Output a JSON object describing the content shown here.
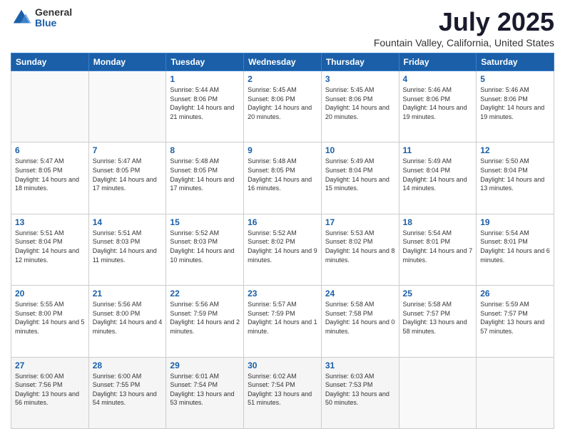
{
  "header": {
    "logo": {
      "general": "General",
      "blue": "Blue"
    },
    "title": "July 2025",
    "subtitle": "Fountain Valley, California, United States"
  },
  "calendar": {
    "weekdays": [
      "Sunday",
      "Monday",
      "Tuesday",
      "Wednesday",
      "Thursday",
      "Friday",
      "Saturday"
    ],
    "weeks": [
      [
        {
          "day": "",
          "sunrise": "",
          "sunset": "",
          "daylight": ""
        },
        {
          "day": "",
          "sunrise": "",
          "sunset": "",
          "daylight": ""
        },
        {
          "day": "1",
          "sunrise": "Sunrise: 5:44 AM",
          "sunset": "Sunset: 8:06 PM",
          "daylight": "Daylight: 14 hours and 21 minutes."
        },
        {
          "day": "2",
          "sunrise": "Sunrise: 5:45 AM",
          "sunset": "Sunset: 8:06 PM",
          "daylight": "Daylight: 14 hours and 20 minutes."
        },
        {
          "day": "3",
          "sunrise": "Sunrise: 5:45 AM",
          "sunset": "Sunset: 8:06 PM",
          "daylight": "Daylight: 14 hours and 20 minutes."
        },
        {
          "day": "4",
          "sunrise": "Sunrise: 5:46 AM",
          "sunset": "Sunset: 8:06 PM",
          "daylight": "Daylight: 14 hours and 19 minutes."
        },
        {
          "day": "5",
          "sunrise": "Sunrise: 5:46 AM",
          "sunset": "Sunset: 8:06 PM",
          "daylight": "Daylight: 14 hours and 19 minutes."
        }
      ],
      [
        {
          "day": "6",
          "sunrise": "Sunrise: 5:47 AM",
          "sunset": "Sunset: 8:05 PM",
          "daylight": "Daylight: 14 hours and 18 minutes."
        },
        {
          "day": "7",
          "sunrise": "Sunrise: 5:47 AM",
          "sunset": "Sunset: 8:05 PM",
          "daylight": "Daylight: 14 hours and 17 minutes."
        },
        {
          "day": "8",
          "sunrise": "Sunrise: 5:48 AM",
          "sunset": "Sunset: 8:05 PM",
          "daylight": "Daylight: 14 hours and 17 minutes."
        },
        {
          "day": "9",
          "sunrise": "Sunrise: 5:48 AM",
          "sunset": "Sunset: 8:05 PM",
          "daylight": "Daylight: 14 hours and 16 minutes."
        },
        {
          "day": "10",
          "sunrise": "Sunrise: 5:49 AM",
          "sunset": "Sunset: 8:04 PM",
          "daylight": "Daylight: 14 hours and 15 minutes."
        },
        {
          "day": "11",
          "sunrise": "Sunrise: 5:49 AM",
          "sunset": "Sunset: 8:04 PM",
          "daylight": "Daylight: 14 hours and 14 minutes."
        },
        {
          "day": "12",
          "sunrise": "Sunrise: 5:50 AM",
          "sunset": "Sunset: 8:04 PM",
          "daylight": "Daylight: 14 hours and 13 minutes."
        }
      ],
      [
        {
          "day": "13",
          "sunrise": "Sunrise: 5:51 AM",
          "sunset": "Sunset: 8:04 PM",
          "daylight": "Daylight: 14 hours and 12 minutes."
        },
        {
          "day": "14",
          "sunrise": "Sunrise: 5:51 AM",
          "sunset": "Sunset: 8:03 PM",
          "daylight": "Daylight: 14 hours and 11 minutes."
        },
        {
          "day": "15",
          "sunrise": "Sunrise: 5:52 AM",
          "sunset": "Sunset: 8:03 PM",
          "daylight": "Daylight: 14 hours and 10 minutes."
        },
        {
          "day": "16",
          "sunrise": "Sunrise: 5:52 AM",
          "sunset": "Sunset: 8:02 PM",
          "daylight": "Daylight: 14 hours and 9 minutes."
        },
        {
          "day": "17",
          "sunrise": "Sunrise: 5:53 AM",
          "sunset": "Sunset: 8:02 PM",
          "daylight": "Daylight: 14 hours and 8 minutes."
        },
        {
          "day": "18",
          "sunrise": "Sunrise: 5:54 AM",
          "sunset": "Sunset: 8:01 PM",
          "daylight": "Daylight: 14 hours and 7 minutes."
        },
        {
          "day": "19",
          "sunrise": "Sunrise: 5:54 AM",
          "sunset": "Sunset: 8:01 PM",
          "daylight": "Daylight: 14 hours and 6 minutes."
        }
      ],
      [
        {
          "day": "20",
          "sunrise": "Sunrise: 5:55 AM",
          "sunset": "Sunset: 8:00 PM",
          "daylight": "Daylight: 14 hours and 5 minutes."
        },
        {
          "day": "21",
          "sunrise": "Sunrise: 5:56 AM",
          "sunset": "Sunset: 8:00 PM",
          "daylight": "Daylight: 14 hours and 4 minutes."
        },
        {
          "day": "22",
          "sunrise": "Sunrise: 5:56 AM",
          "sunset": "Sunset: 7:59 PM",
          "daylight": "Daylight: 14 hours and 2 minutes."
        },
        {
          "day": "23",
          "sunrise": "Sunrise: 5:57 AM",
          "sunset": "Sunset: 7:59 PM",
          "daylight": "Daylight: 14 hours and 1 minute."
        },
        {
          "day": "24",
          "sunrise": "Sunrise: 5:58 AM",
          "sunset": "Sunset: 7:58 PM",
          "daylight": "Daylight: 14 hours and 0 minutes."
        },
        {
          "day": "25",
          "sunrise": "Sunrise: 5:58 AM",
          "sunset": "Sunset: 7:57 PM",
          "daylight": "Daylight: 13 hours and 58 minutes."
        },
        {
          "day": "26",
          "sunrise": "Sunrise: 5:59 AM",
          "sunset": "Sunset: 7:57 PM",
          "daylight": "Daylight: 13 hours and 57 minutes."
        }
      ],
      [
        {
          "day": "27",
          "sunrise": "Sunrise: 6:00 AM",
          "sunset": "Sunset: 7:56 PM",
          "daylight": "Daylight: 13 hours and 56 minutes."
        },
        {
          "day": "28",
          "sunrise": "Sunrise: 6:00 AM",
          "sunset": "Sunset: 7:55 PM",
          "daylight": "Daylight: 13 hours and 54 minutes."
        },
        {
          "day": "29",
          "sunrise": "Sunrise: 6:01 AM",
          "sunset": "Sunset: 7:54 PM",
          "daylight": "Daylight: 13 hours and 53 minutes."
        },
        {
          "day": "30",
          "sunrise": "Sunrise: 6:02 AM",
          "sunset": "Sunset: 7:54 PM",
          "daylight": "Daylight: 13 hours and 51 minutes."
        },
        {
          "day": "31",
          "sunrise": "Sunrise: 6:03 AM",
          "sunset": "Sunset: 7:53 PM",
          "daylight": "Daylight: 13 hours and 50 minutes."
        },
        {
          "day": "",
          "sunrise": "",
          "sunset": "",
          "daylight": ""
        },
        {
          "day": "",
          "sunrise": "",
          "sunset": "",
          "daylight": ""
        }
      ]
    ]
  }
}
